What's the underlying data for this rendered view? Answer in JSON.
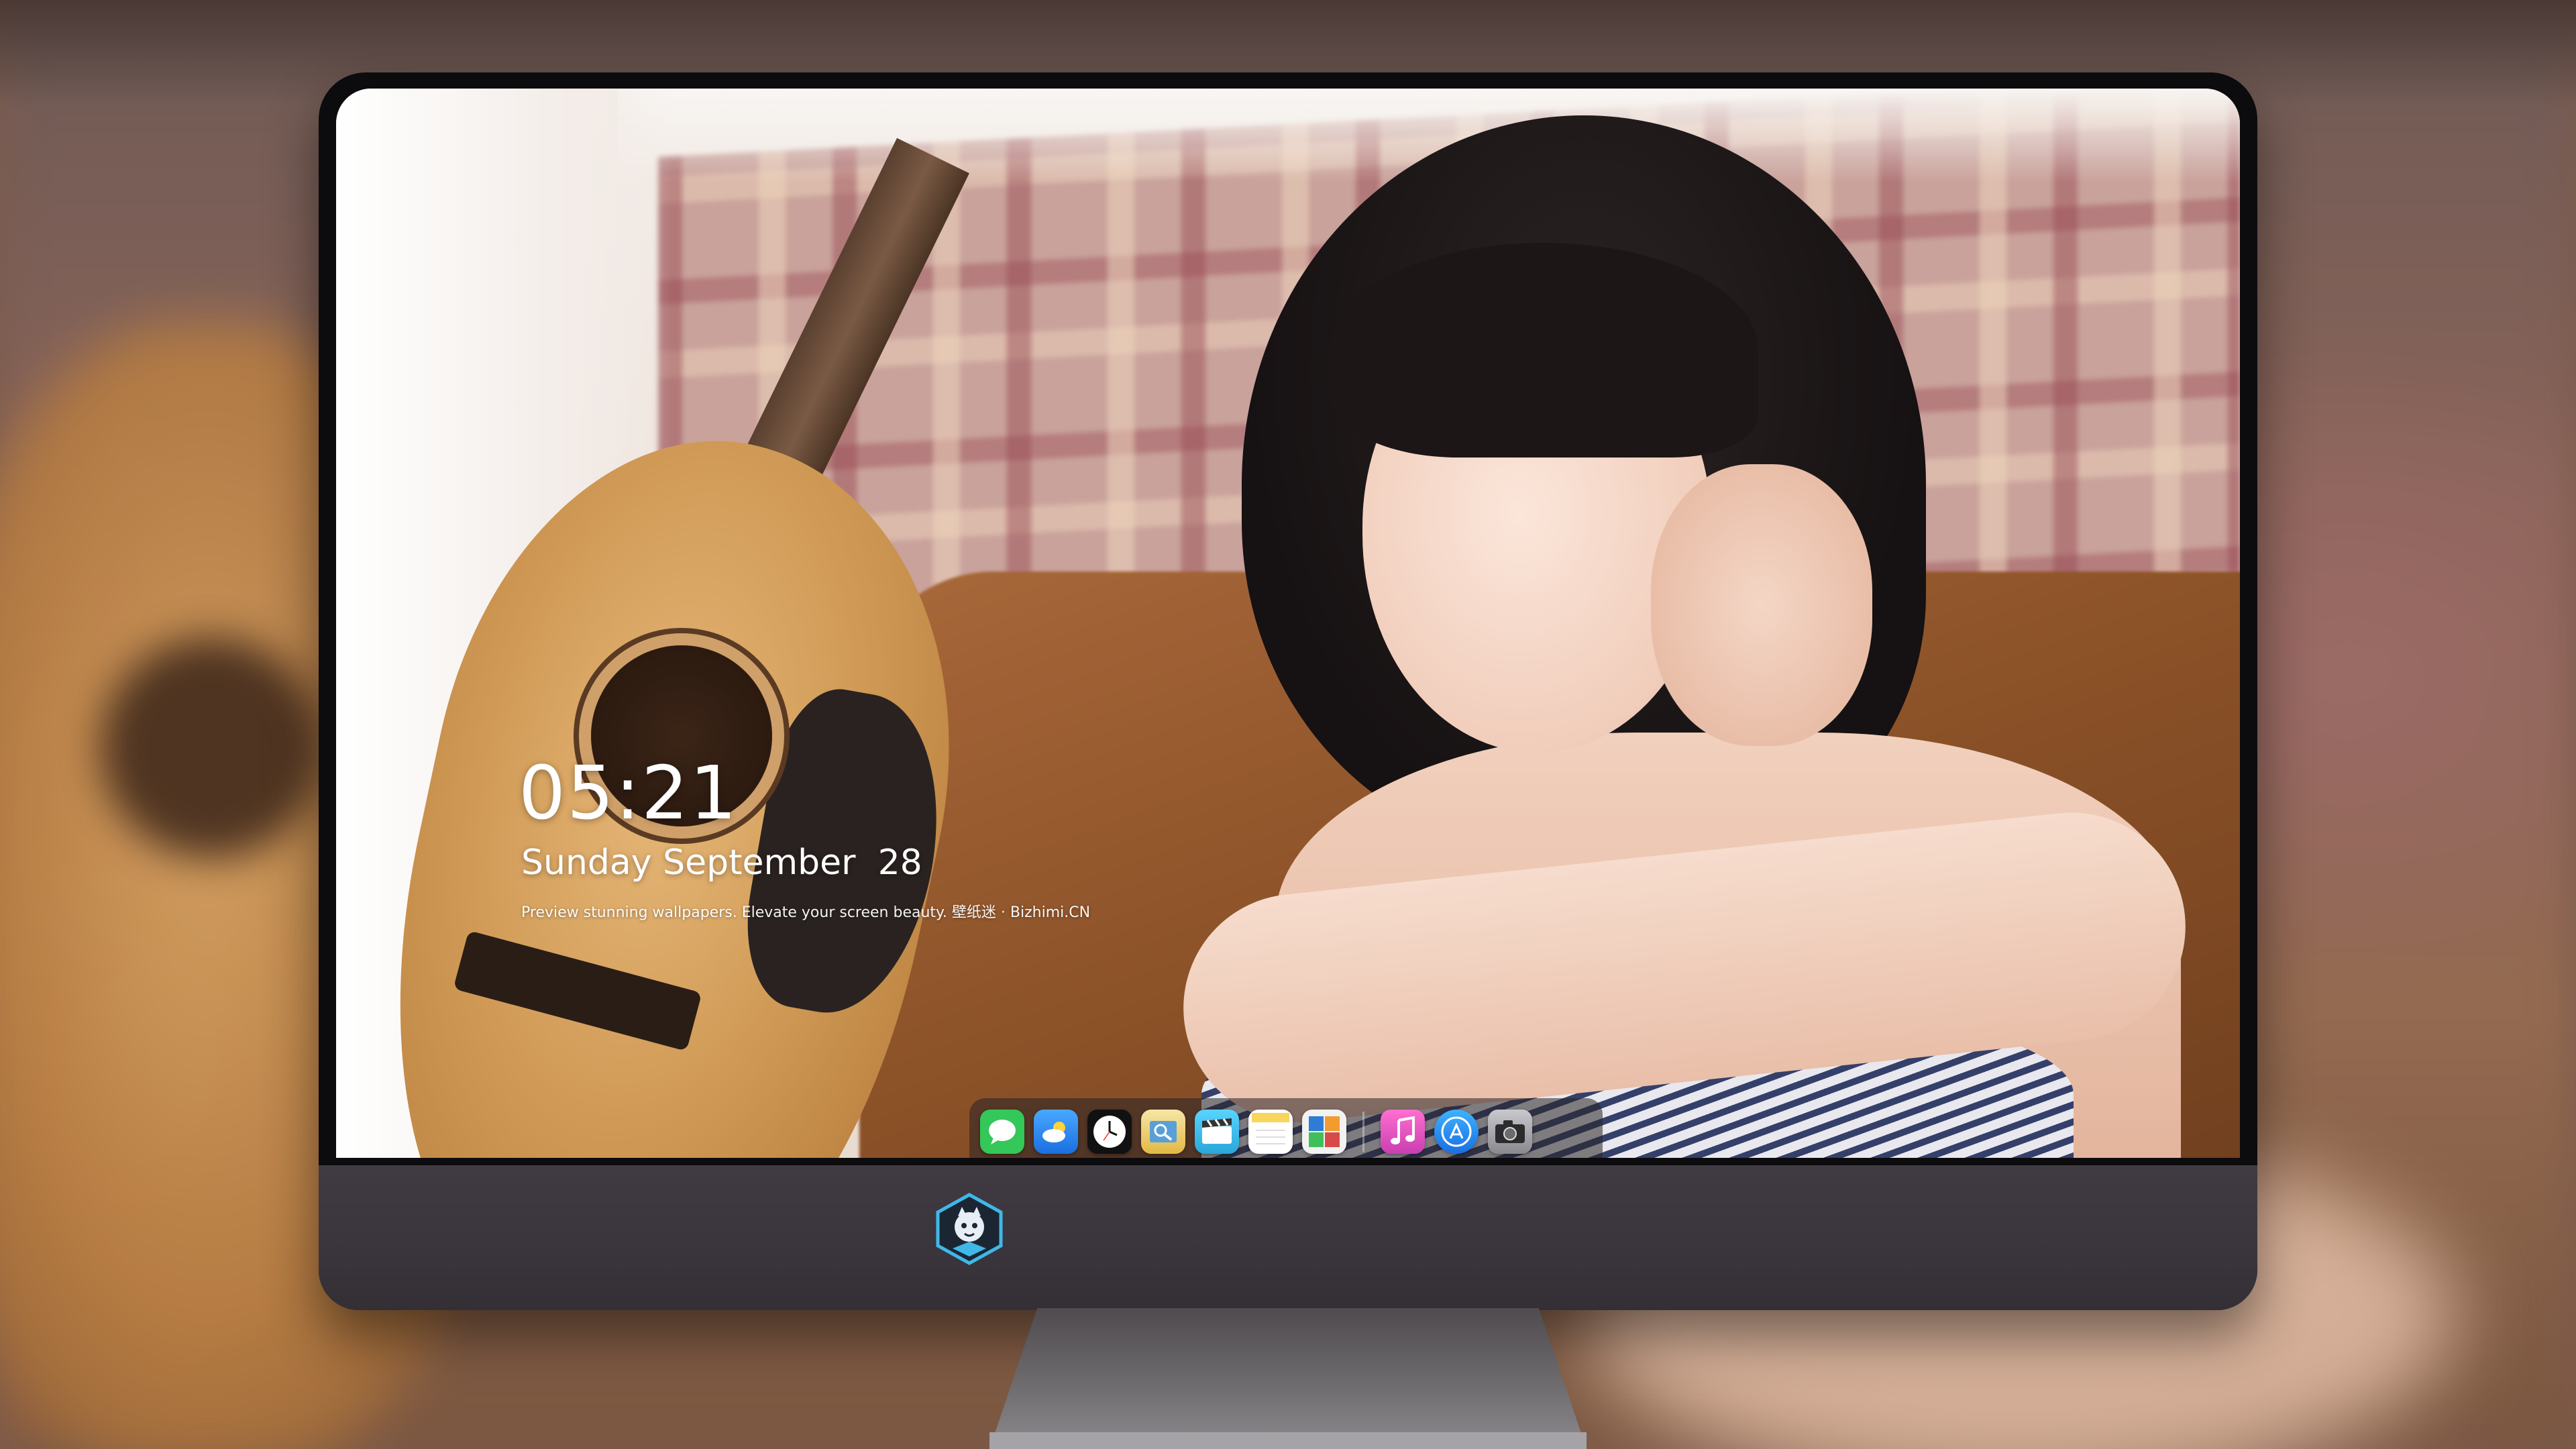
{
  "lockscreen": {
    "time": "05:21",
    "date": "Sunday September  28",
    "tagline": "Preview stunning wallpapers. Elevate your screen beauty. 壁纸迷 · Bizhimi.CN"
  },
  "dock": {
    "apps": [
      {
        "name": "Messages",
        "icon": "messages-icon",
        "color": "#34c759"
      },
      {
        "name": "Weather",
        "icon": "weather-icon",
        "color": "#1e8fff"
      },
      {
        "name": "Clock",
        "icon": "clock-icon",
        "color": "#111111"
      },
      {
        "name": "Preview",
        "icon": "preview-icon",
        "color": "#e8c75a"
      },
      {
        "name": "Clips",
        "icon": "clips-icon",
        "color": "#3ec3f2"
      },
      {
        "name": "Notes",
        "icon": "notes-icon",
        "color": "#f9d65b"
      },
      {
        "name": "Photo Booth",
        "icon": "photo-booth-icon",
        "color": "#2f7cd4"
      },
      {
        "name": "Music",
        "icon": "music-icon",
        "color": "#e64bb8"
      },
      {
        "name": "App Store",
        "icon": "app-store-icon",
        "color": "#1f8cff"
      },
      {
        "name": "Camera",
        "icon": "camera-icon",
        "color": "#8a8a8e"
      }
    ]
  },
  "monitor": {
    "logo": "bizhimi-logo-icon"
  }
}
